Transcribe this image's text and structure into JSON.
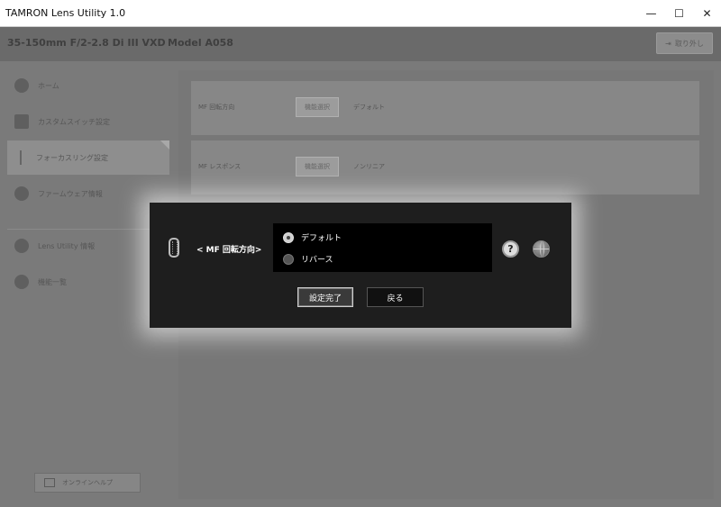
{
  "window": {
    "title": "TAMRON Lens Utility  1.0",
    "minimize": "—",
    "maximize": "☐",
    "close": "✕"
  },
  "header": {
    "lens_name": "35-150mm F/2-2.8 Di III VXD",
    "model": "Model A058",
    "detach_label": "取り外し"
  },
  "sidebar": {
    "items": [
      {
        "label": "ホーム",
        "icon": "home-icon"
      },
      {
        "label": "カスタムスイッチ設定",
        "icon": "switch-icon"
      },
      {
        "label": "フォーカスリング設定",
        "icon": "focus-ring-icon"
      },
      {
        "label": "ファームウェア情報",
        "icon": "firmware-icon"
      },
      {
        "label": "Lens Utility 情報",
        "icon": "info-icon"
      },
      {
        "label": "機能一覧",
        "icon": "help-circle-icon"
      }
    ],
    "online_help_label": "オンラインヘルプ"
  },
  "main": {
    "rows": [
      {
        "label": "MF 回転方向",
        "button": "機能選択",
        "value": "デフォルト"
      },
      {
        "label": "MF レスポンス",
        "button": "機能選択",
        "value": "ノンリニア"
      }
    ]
  },
  "dialog": {
    "title": "< MF 回転方向>",
    "options": [
      {
        "label": "デフォルト",
        "selected": true
      },
      {
        "label": "リバース",
        "selected": false
      }
    ],
    "help_glyph": "?",
    "confirm_label": "設定完了",
    "back_label": "戻る"
  }
}
